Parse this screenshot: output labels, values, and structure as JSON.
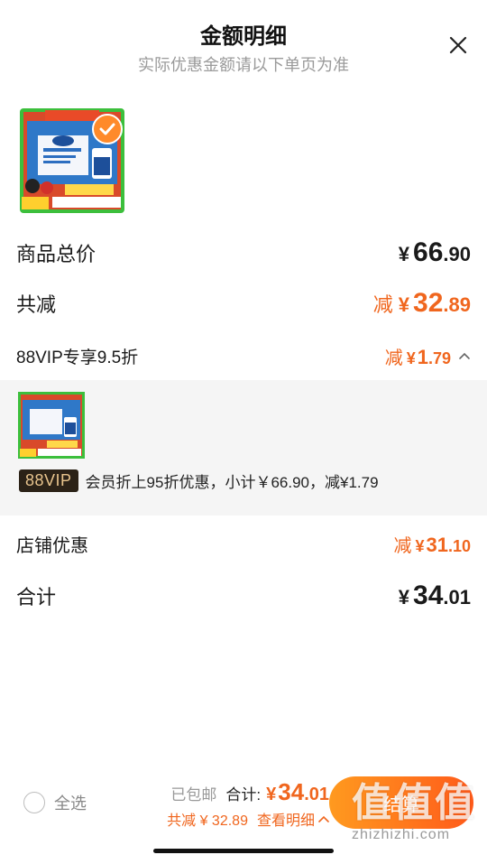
{
  "header": {
    "title": "金额明细",
    "subtitle": "实际优惠金额请以下单页为准"
  },
  "product": {
    "thumb_banner": "天猫超市年货节",
    "thumb_promo": "月度优质福物",
    "thumb_footer": "只选用纯正生牛乳发酵",
    "thumb_guarantee": "正品保障"
  },
  "rows": {
    "goods_total": {
      "label": "商品总价",
      "yen": "¥",
      "int": "66",
      "dec": ".90"
    },
    "total_discount": {
      "label": "共减",
      "prefix": "减",
      "yen": "¥",
      "int": "32",
      "dec": ".89"
    },
    "vip": {
      "label": "88VIP专享9.5折",
      "prefix": "减",
      "yen": "¥",
      "int": "1",
      "dec": ".79"
    },
    "shop_discount": {
      "label": "店铺优惠",
      "prefix": "减",
      "yen": "¥",
      "int": "31",
      "dec": ".10"
    },
    "subtotal": {
      "label": "合计",
      "yen": "¥",
      "int": "34",
      "dec": ".01"
    }
  },
  "vip_detail": {
    "tag": "88VIP",
    "text": "会员折上95折优惠，小计￥66.90，减¥1.79"
  },
  "bottom_bar": {
    "select_all": "全选",
    "shipped": "已包邮",
    "total_label": "合计:",
    "total_yen": "¥",
    "total_int": "34",
    "total_dec": ".01",
    "discount_summary": "共减 ¥ 32.89",
    "detail_link": "查看明细",
    "checkout": "结算"
  },
  "watermark": {
    "main": "值值值",
    "url": "zhizhizhi.com"
  },
  "colors": {
    "accent": "#f0661e",
    "vip_tag_bg": "#2b2217",
    "vip_tag_text": "#e8c48d",
    "detail_bg": "#f5f5f5"
  }
}
